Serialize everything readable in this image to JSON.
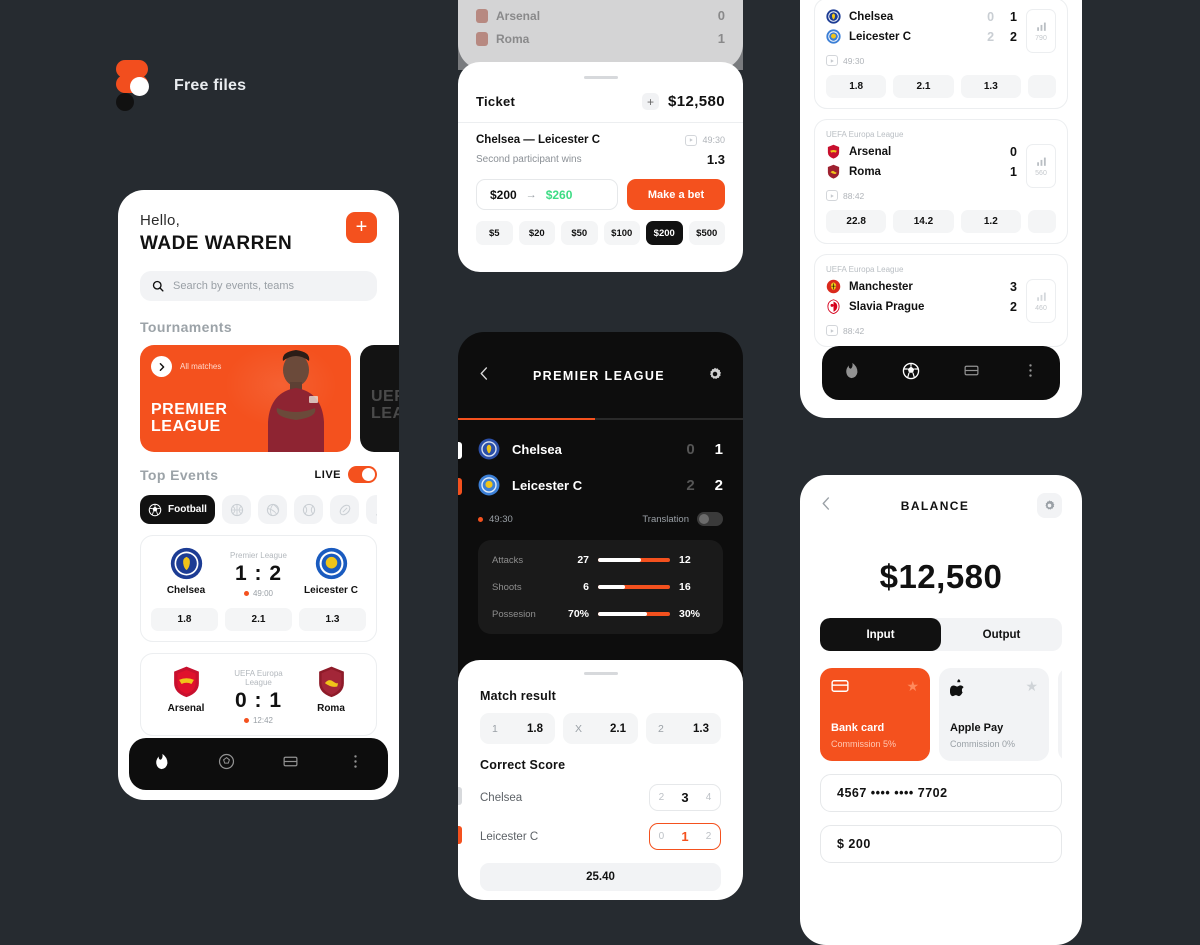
{
  "brand": {
    "label": "Free files"
  },
  "colors": {
    "accent": "#f4511e",
    "dark": "#0d0d0d",
    "green": "#3ddc84",
    "bg": "#262b30"
  },
  "home": {
    "greeting": "Hello,",
    "user_name": "WADE WARREN",
    "add_button": "+",
    "search_placeholder": "Search by events, teams",
    "tournaments_title": "Tournaments",
    "tournament_cards": [
      {
        "all_matches": "All matches",
        "name_line1": "PREMIER",
        "name_line2": "LEAGUE"
      },
      {
        "name_line1": "UEFA",
        "name_line2": "LEAGUE"
      }
    ],
    "top_events_title": "Top Events",
    "live_label": "LIVE",
    "live_on": true,
    "sports": [
      {
        "name": "Football",
        "icon": "soccer-ball-icon",
        "active": true
      },
      {
        "name": "Basketball",
        "icon": "basketball-icon",
        "active": false
      },
      {
        "name": "Volleyball",
        "icon": "volleyball-icon",
        "active": false
      },
      {
        "name": "Tennis",
        "icon": "tennis-ball-icon",
        "active": false
      },
      {
        "name": "Rugby",
        "icon": "rugby-ball-icon",
        "active": false
      },
      {
        "name": "Hockey",
        "icon": "hockey-stick-icon",
        "active": false
      }
    ],
    "matches": [
      {
        "league": "Premier League",
        "home": "Chelsea",
        "away": "Leicester C",
        "score": "1 : 2",
        "time": "49:00",
        "odds": [
          "1.8",
          "2.1",
          "1.3"
        ]
      },
      {
        "league": "UEFA Europa League",
        "home": "Arsenal",
        "away": "Roma",
        "score": "0 : 1",
        "time": "12:42",
        "odds": [
          "",
          "",
          ""
        ]
      }
    ],
    "nav": [
      {
        "icon": "flame-icon",
        "active": true
      },
      {
        "icon": "soccer-ball-icon",
        "active": false
      },
      {
        "icon": "cards-icon",
        "active": false
      },
      {
        "icon": "more-dots-icon",
        "active": false
      }
    ]
  },
  "ticket": {
    "background_rows": [
      {
        "team": "Arsenal",
        "score": "0"
      },
      {
        "team": "Roma",
        "score": "1"
      }
    ],
    "title": "Ticket",
    "add_icon": "+",
    "amount": "$12,580",
    "match": "Chelsea — Leicester C",
    "match_time": "49:30",
    "bet_type": "Second participant wins",
    "bet_odd": "1.3",
    "stake": "$200",
    "arrow": "→",
    "payout": "$260",
    "bet_button": "Make a bet",
    "quick_amounts": [
      "$5",
      "$20",
      "$50",
      "$100",
      "$200",
      "$500"
    ],
    "quick_selected": "$200"
  },
  "match_detail": {
    "back_icon": "chevron-left-icon",
    "title": "PREMIER LEAGUE",
    "settings_icon": "gear-icon",
    "progress_percent": 48,
    "teams": [
      {
        "name": "Chelsea",
        "score_dim": "0",
        "score_lit": "1",
        "marker": "#ffffff"
      },
      {
        "name": "Leicester C",
        "score_dim": "2",
        "score_lit": "2",
        "marker": "#f4511e"
      }
    ],
    "time": "49:30",
    "translation_label": "Translation",
    "translation_on": false,
    "stats": [
      {
        "label": "Attacks",
        "home": "27",
        "away": "12",
        "home_pct": 60
      },
      {
        "label": "Shoots",
        "home": "6",
        "away": "16",
        "home_pct": 38
      },
      {
        "label": "Possesion",
        "home": "70%",
        "away": "30%",
        "home_pct": 68
      }
    ],
    "sheet": {
      "match_result_title": "Match result",
      "match_result": [
        {
          "key": "1",
          "value": "1.8"
        },
        {
          "key": "X",
          "value": "2.1"
        },
        {
          "key": "2",
          "value": "1.3"
        }
      ],
      "correct_score_title": "Correct Score",
      "correct_score": [
        {
          "team": "Chelsea",
          "options": [
            "2",
            "3",
            "4"
          ],
          "selected_index": 1,
          "highlight": false,
          "marker": "#d7d9dc"
        },
        {
          "team": "Leicester C",
          "options": [
            "0",
            "1",
            "2"
          ],
          "selected_index": 1,
          "highlight": true,
          "marker": "#f4511e"
        }
      ],
      "total": "25.40"
    }
  },
  "match_list": {
    "cards": [
      {
        "league": "",
        "teams": [
          {
            "name": "Chelsea",
            "score_dim": "0",
            "score_lit": "1"
          },
          {
            "name": "Leicester C",
            "score_dim": "2",
            "score_lit": "2"
          }
        ],
        "time": "49:30",
        "stat_count": "790",
        "odds": [
          "1.8",
          "2.1",
          "1.3"
        ]
      },
      {
        "league": "UEFA Europa League",
        "teams": [
          {
            "name": "Arsenal",
            "score_dim": "",
            "score_lit": "0"
          },
          {
            "name": "Roma",
            "score_dim": "",
            "score_lit": "1"
          }
        ],
        "time": "88:42",
        "stat_count": "560",
        "odds": [
          "22.8",
          "14.2",
          "1.2"
        ]
      },
      {
        "league": "UEFA Europa League",
        "teams": [
          {
            "name": "Manchester",
            "score_dim": "",
            "score_lit": "3"
          },
          {
            "name": "Slavia Prague",
            "score_dim": "",
            "score_lit": "2"
          }
        ],
        "time": "88:42",
        "stat_count": "460",
        "odds": [
          "",
          "",
          ""
        ]
      }
    ],
    "nav": [
      {
        "icon": "flame-icon",
        "active": false
      },
      {
        "icon": "soccer-ball-icon",
        "active": true
      },
      {
        "icon": "cards-icon",
        "active": false
      },
      {
        "icon": "more-dots-icon",
        "active": false
      }
    ]
  },
  "balance": {
    "back_icon": "chevron-left-icon",
    "title": "BALANCE",
    "settings_icon": "gear-icon",
    "amount": "$12,580",
    "tabs": [
      {
        "label": "Input",
        "active": true
      },
      {
        "label": "Output",
        "active": false
      }
    ],
    "methods": [
      {
        "name": "Bank card",
        "commission": "Commission 5%",
        "icon": "credit-card-icon",
        "selected": true
      },
      {
        "name": "Apple Pay",
        "commission": "Commission 0%",
        "icon": "apple-icon",
        "selected": false
      }
    ],
    "card_number": "4567 •••• •••• 7702",
    "amount_field": "$ 200"
  }
}
